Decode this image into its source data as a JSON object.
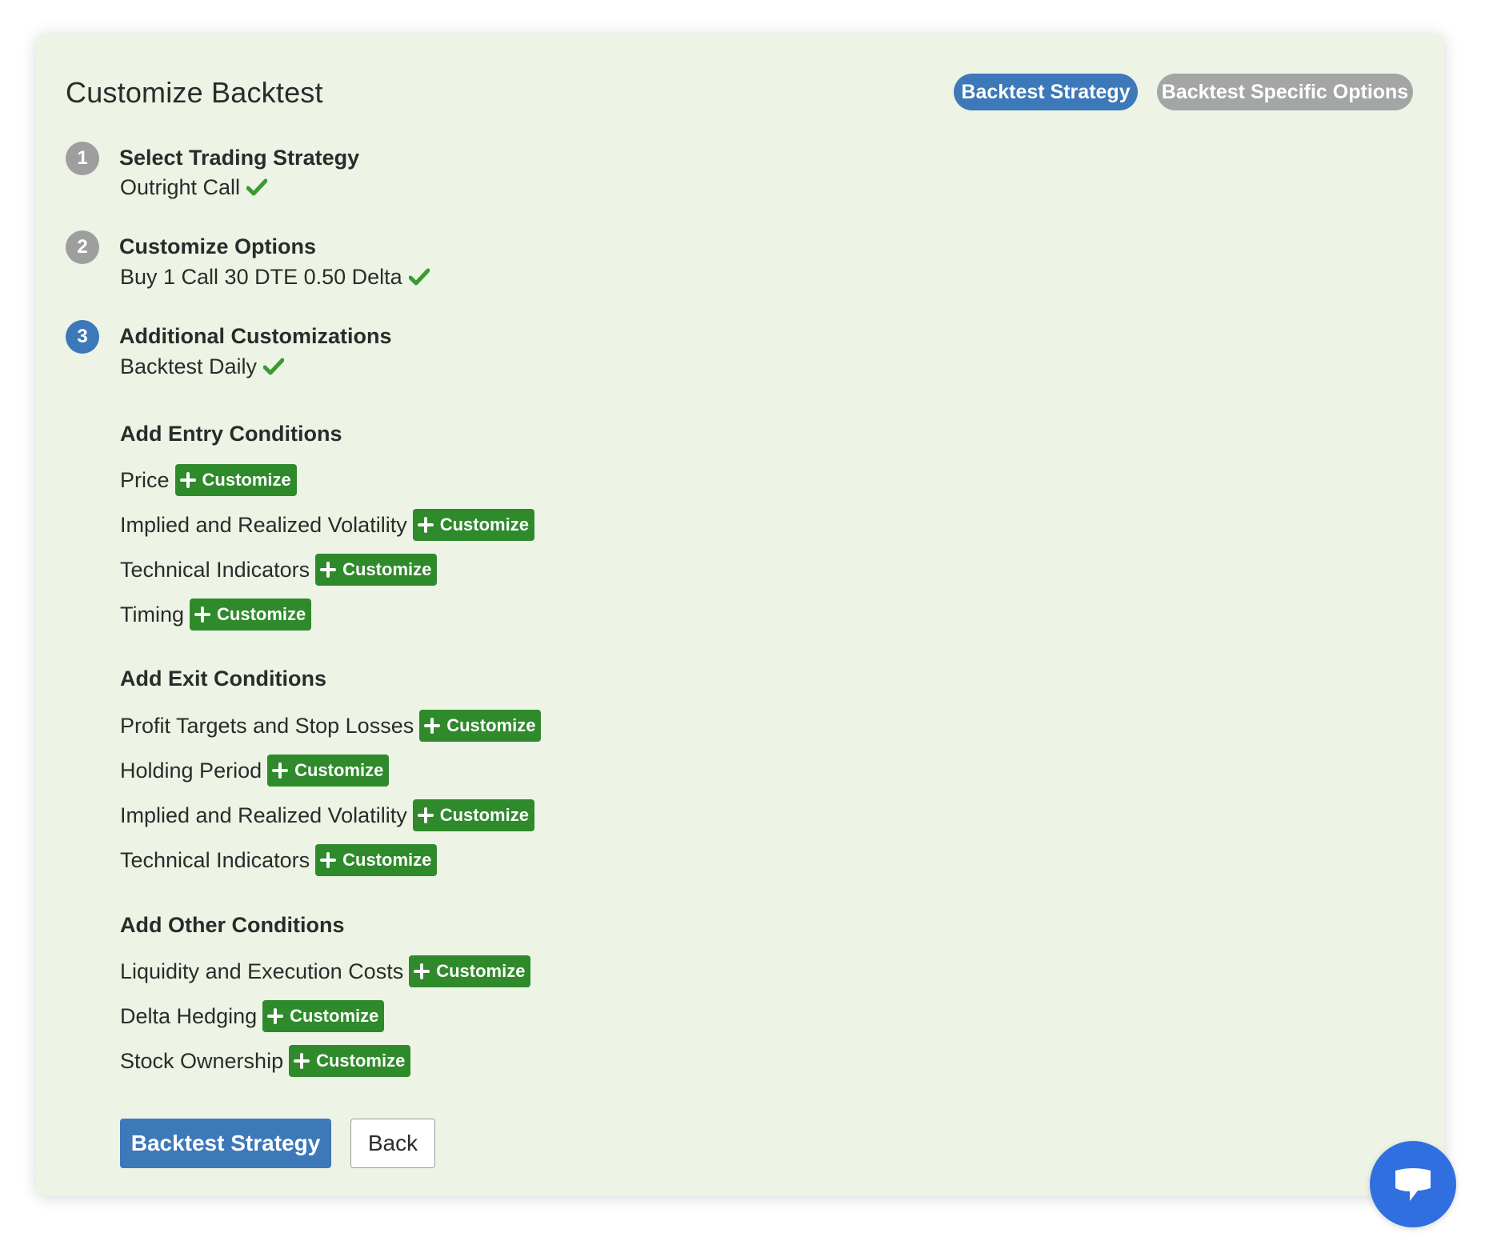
{
  "header": {
    "title": "Customize Backtest",
    "tabs": [
      {
        "label": "Backtest Strategy",
        "active": true
      },
      {
        "label": "Backtest Specific Options",
        "active": false
      }
    ]
  },
  "steps": [
    {
      "number": "1",
      "title": "Select Trading Strategy",
      "value": "Outright Call",
      "complete": true
    },
    {
      "number": "2",
      "title": "Customize Options",
      "value": "Buy 1 Call 30 DTE 0.50 Delta",
      "complete": true
    },
    {
      "number": "3",
      "title": "Additional Customizations",
      "value": "Backtest Daily",
      "complete": true,
      "current": true
    }
  ],
  "entry": {
    "heading": "Add Entry Conditions",
    "items": [
      "Price",
      "Implied and Realized Volatility",
      "Technical Indicators",
      "Timing"
    ]
  },
  "exit": {
    "heading": "Add Exit Conditions",
    "items": [
      "Profit Targets and Stop Losses",
      "Holding Period",
      "Implied and Realized Volatility",
      "Technical Indicators"
    ]
  },
  "other": {
    "heading": "Add Other Conditions",
    "items": [
      "Liquidity and Execution Costs",
      "Delta Hedging",
      "Stock Ownership"
    ]
  },
  "customize_label": "Customize",
  "footer": {
    "primary_label": "Backtest Strategy",
    "back_label": "Back"
  },
  "icons": {
    "check": "check-icon",
    "plus": "plus-icon",
    "chat": "chat-bubble-icon"
  },
  "colors": {
    "accent_blue": "#3d78b8",
    "customize_green": "#2f8a2b",
    "check_green": "#3a9a2f",
    "inactive_gray": "#a3a6a5",
    "panel_bg": "#edf4e6",
    "chat_blue": "#2f6fe0"
  }
}
